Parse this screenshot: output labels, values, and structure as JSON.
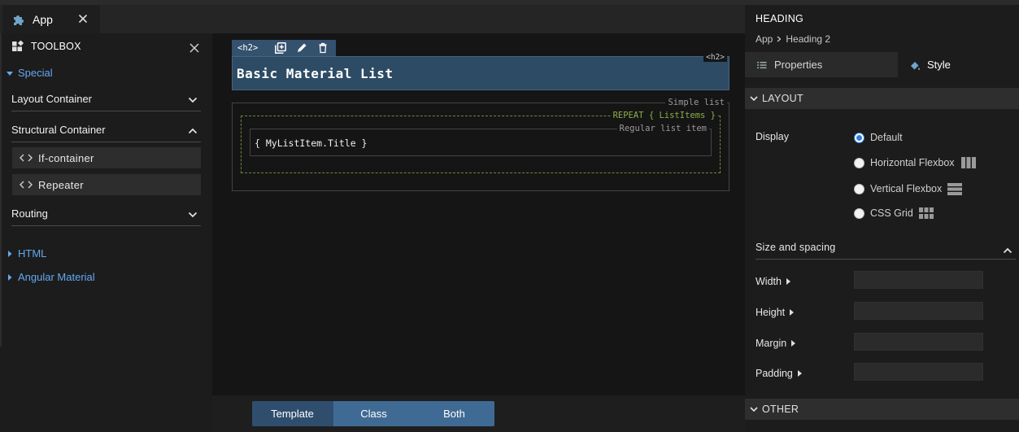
{
  "tab": {
    "label": "App"
  },
  "toolbox": {
    "title": "TOOLBOX",
    "special_label": "Special",
    "sections": [
      {
        "label": "Layout Container",
        "expanded": false
      },
      {
        "label": "Structural Container",
        "expanded": true
      },
      {
        "label": "Routing",
        "expanded": false
      }
    ],
    "structural_items": [
      {
        "label": "If-container"
      },
      {
        "label": "Repeater"
      }
    ],
    "categories": [
      {
        "label": "HTML"
      },
      {
        "label": "Angular Material"
      }
    ]
  },
  "canvas": {
    "element_tag": "<h2>",
    "heading_tag_label": "<h2>",
    "heading_text": "Basic Material List",
    "simple_list_label": "Simple list",
    "repeat_label": "REPEAT { ListItems }",
    "list_item_label": "Regular list item",
    "list_item_expression": "{ MyListItem.Title }"
  },
  "view_toggle": {
    "options": [
      "Template",
      "Class",
      "Both"
    ],
    "selected": "Template"
  },
  "inspector": {
    "title": "HEADING",
    "breadcrumb": [
      "App",
      "Heading 2"
    ],
    "tabs": [
      {
        "label": "Properties"
      },
      {
        "label": "Style"
      }
    ],
    "active_tab": "Style",
    "layout_group": "LAYOUT",
    "display_label": "Display",
    "display_options": [
      "Default",
      "Horizontal Flexbox",
      "Vertical Flexbox",
      "CSS Grid"
    ],
    "display_selected": "Default",
    "size_spacing_label": "Size and spacing",
    "props": [
      {
        "label": "Width",
        "value": ""
      },
      {
        "label": "Height",
        "value": ""
      },
      {
        "label": "Margin",
        "value": ""
      },
      {
        "label": "Padding",
        "value": ""
      }
    ],
    "other_group": "OTHER"
  },
  "colors": {
    "accent": "#64a8f0",
    "selected_header": "#2d4b64",
    "repeat_border": "#6b8a38",
    "toggle": "#3f6a94"
  }
}
